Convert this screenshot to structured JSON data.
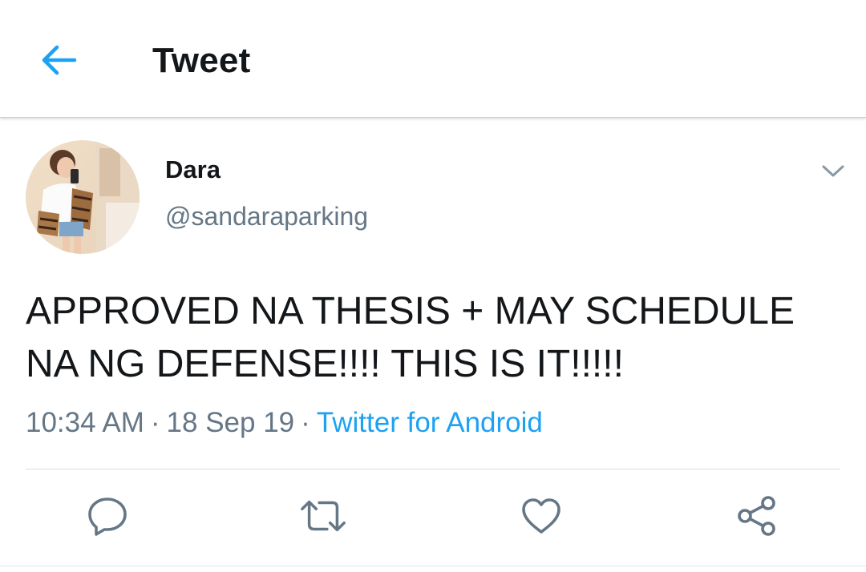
{
  "header": {
    "title": "Tweet",
    "back_icon": "arrow-left-icon",
    "accent_color": "#1da1f2"
  },
  "tweet": {
    "author": {
      "name": "Dara",
      "handle": "@sandaraparking",
      "avatar_icon": "profile-photo"
    },
    "text": "APPROVED NA THESIS + MAY SCHEDULE\nNA NG DEFENSE!!!! THIS IS IT!!!!!",
    "time": "10:34 AM",
    "separator": "·",
    "date": "18 Sep 19",
    "source": "Twitter for Android"
  },
  "actions": [
    {
      "name": "reply",
      "icon": "reply-icon"
    },
    {
      "name": "retweet",
      "icon": "retweet-icon"
    },
    {
      "name": "like",
      "icon": "heart-icon"
    },
    {
      "name": "share",
      "icon": "share-icon"
    }
  ],
  "colors": {
    "text": "#14171a",
    "secondary": "#657786",
    "link": "#1da1f2",
    "icon": "#657786"
  }
}
